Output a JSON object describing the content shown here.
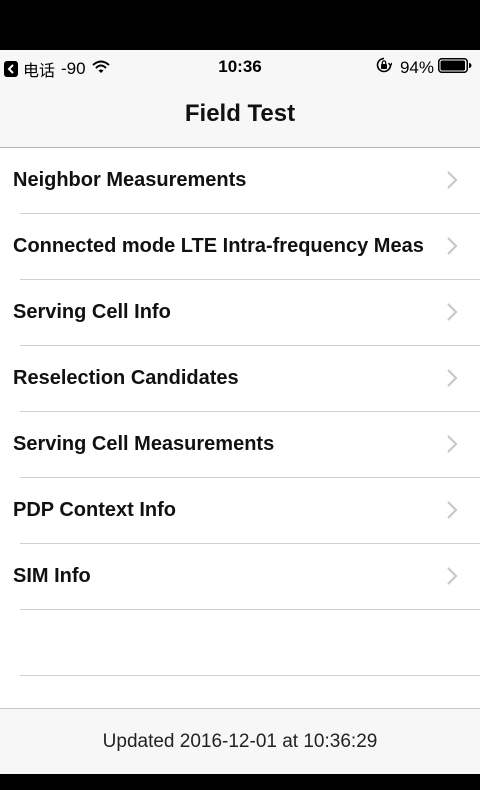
{
  "status_bar": {
    "carrier": "电话",
    "signal": "-90",
    "time": "10:36",
    "battery_percent": "94%",
    "icons": [
      "back-to-app-icon",
      "wifi-icon",
      "rotation-lock-icon",
      "battery-icon"
    ]
  },
  "nav": {
    "title": "Field Test"
  },
  "list": {
    "items": [
      {
        "label": "Neighbor Measurements"
      },
      {
        "label": "Connected mode LTE Intra-frequency Meas"
      },
      {
        "label": "Serving Cell Info"
      },
      {
        "label": "Reselection Candidates"
      },
      {
        "label": "Serving Cell Measurements"
      },
      {
        "label": "PDP Context Info"
      },
      {
        "label": "SIM Info"
      }
    ]
  },
  "footer": {
    "text": "Updated 2016-12-01 at 10:36:29"
  },
  "colors": {
    "bar_background": "#f7f7f7",
    "chevron": "#c7c7cc",
    "separator": "#d0d0d0"
  }
}
